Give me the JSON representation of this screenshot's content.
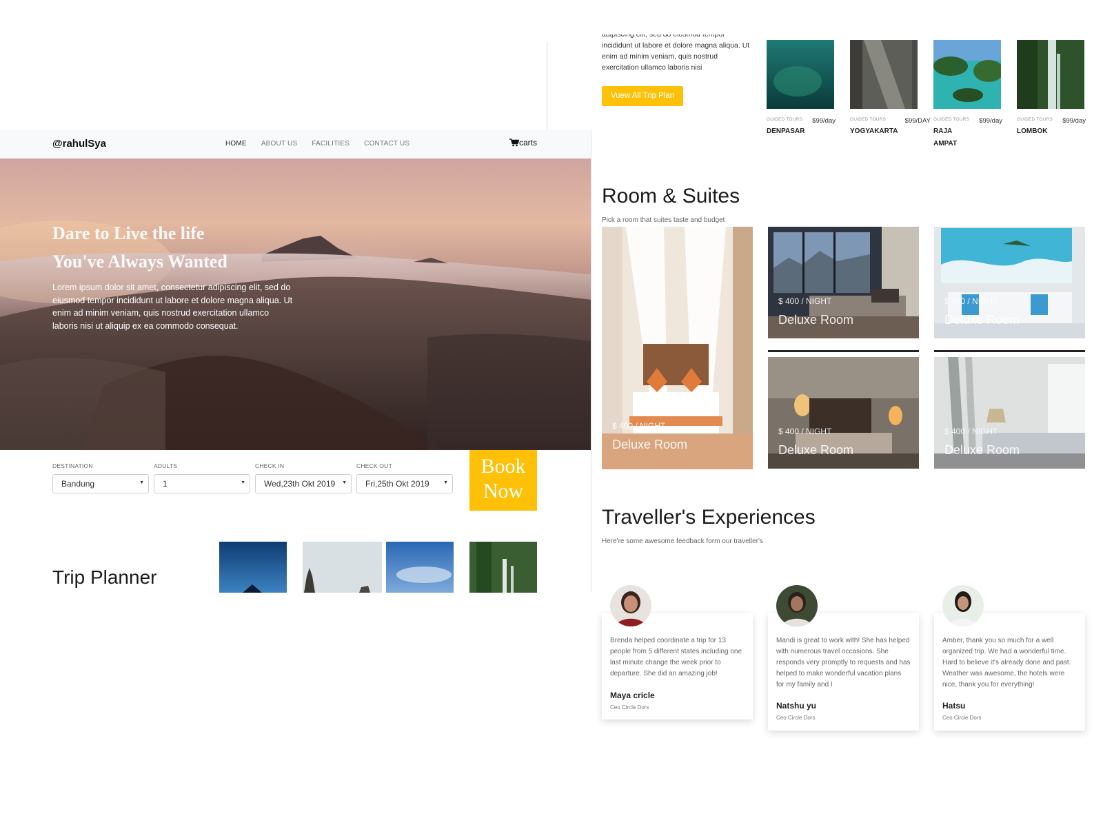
{
  "brand": "@rahulSya",
  "nav": {
    "home": "HOME",
    "about": "ABOUT US",
    "facilities": "FACILITIES",
    "contact": "CONTACT US",
    "carts": "carts"
  },
  "hero": {
    "title_line1": "Dare to Live the life",
    "title_line2": "You've Always Wanted",
    "text": "Lorem ipsum dolor sit amet, consectetur adipiscing elit, sed do eiusmod tempor incididunt ut labore et dolore magna aliqua. Ut enim ad minim veniam, quis nostrud exercitation ullamco laboris nisi ut aliquip ex ea commodo consequat."
  },
  "booking": {
    "destination": {
      "label": "DESTINATION",
      "value": "Bandung"
    },
    "adults": {
      "label": "ADULTS",
      "value": "1"
    },
    "check_in": {
      "label": "CHECK IN",
      "value": "Wed,23th Okt 2019"
    },
    "check_out": {
      "label": "CHECK OUT",
      "value": "Fri,25th Okt 2019"
    },
    "book_line1": "Book",
    "book_line2": "Now"
  },
  "trip_planner": {
    "title": "Trip Planner",
    "intro_cut": "adipiscing elit, sed do eiusmod tempor",
    "intro": "incididunt ut labore et dolore magna aliqua. Ut enim ad minim veniam, quis nostrud exercitation ullamco laboris nisi",
    "button": "Vuew All Trip Plan",
    "destinations": [
      {
        "tag": "GUIDED TOURS",
        "price": "$99/day",
        "name": "DENPASAR"
      },
      {
        "tag": "GUIDED TOURS",
        "price": "$99/DAY",
        "name": "YOGYAKARTA"
      },
      {
        "tag": "GUIDED TOURS",
        "price": "$99/day",
        "name": "RAJA AMPAT"
      },
      {
        "tag": "GUIDED TOURS",
        "price": "$99/day",
        "name": "LOMBOK"
      }
    ]
  },
  "rooms": {
    "title": "Room & Suites",
    "subtitle": "Pick a room that suites taste and budget",
    "items": [
      {
        "price": "$ 400 / NIGHT",
        "name": "Deluxe Room"
      },
      {
        "price": "$ 400 / NIGHT",
        "name": "Deluxe Room"
      },
      {
        "price": "$ 400 / NIGHT",
        "name": "Deluxe Room"
      },
      {
        "price": "$ 400 / NIGHT",
        "name": "Deluxe Room"
      },
      {
        "price": "$ 400 / NIGHT",
        "name": "Deluxe Room"
      }
    ]
  },
  "experiences": {
    "title": "Traveller's Experiences",
    "subtitle": "Here're some awesome feedback form our traveller's",
    "items": [
      {
        "text": "Brenda helped coordinate a trip for 13 people from 5 different states including one last minute change the week prior to departure. She did an amazing job!",
        "name": "Maya cricle",
        "role": "Ceo Circle Dors"
      },
      {
        "text": "Mandi is great to work with! She has helped with numerous travel occasions. She responds very promptly to requests and has helped to make wonderful vacation plans for my family and I",
        "name": "Natshu yu",
        "role": "Ceo Circle Dors"
      },
      {
        "text": "Amber, thank you so much for a well organized trip. We had a wonderful time. Hard to believe it's already done and past. Weather was awesome, the hotels were nice, thank you for everything!",
        "name": "Hatsu",
        "role": "Ceo Circle Dors"
      }
    ]
  },
  "colors": {
    "accent": "#fec107",
    "navbar_bg": "#f8f9fa"
  },
  "icons": {
    "cart": "shopping-cart-icon",
    "dropdown": "caret-down-icon"
  }
}
